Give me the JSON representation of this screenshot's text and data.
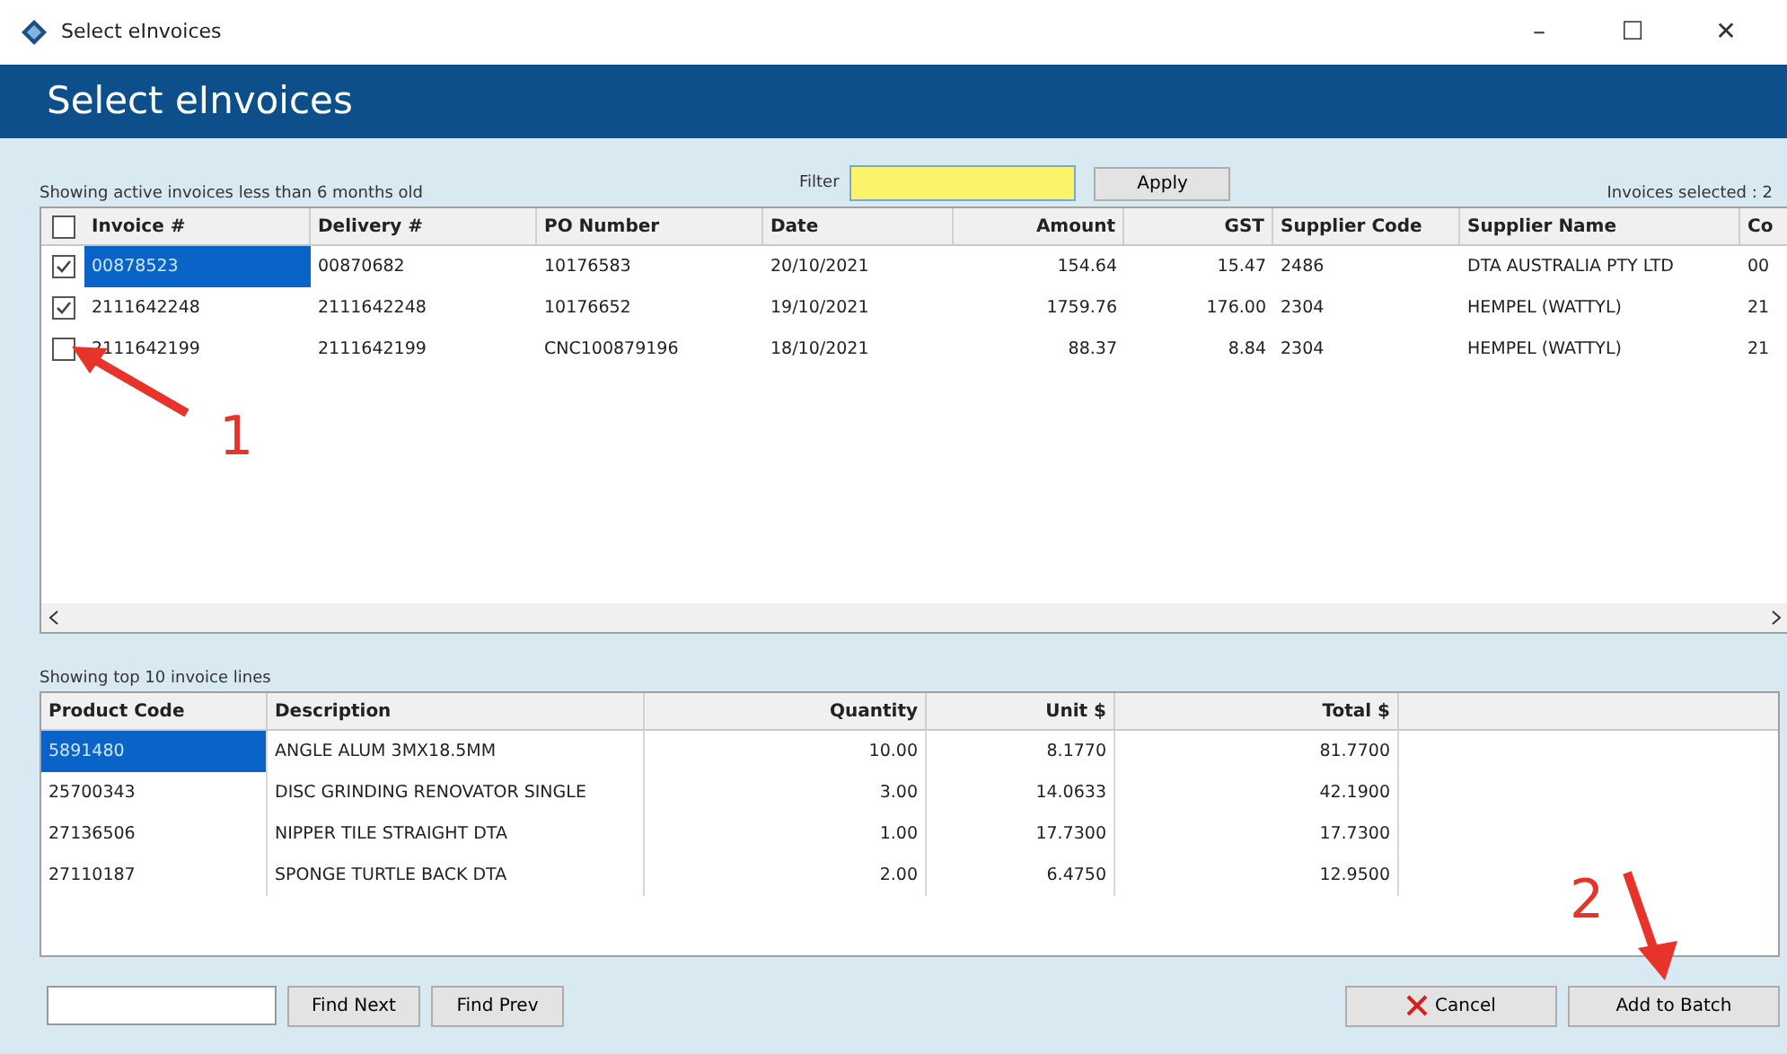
{
  "window": {
    "title": "Select eInvoices",
    "controls": [
      "–",
      "☐",
      "✕"
    ]
  },
  "header": {
    "title": "Select eInvoices"
  },
  "invoices": {
    "caption": "Showing active invoices less than 6 months old",
    "filter_label": "Filter",
    "apply": "Apply",
    "selected_count": "Invoices selected : 2",
    "all_checked": false,
    "columns": [
      "Invoice #",
      "Delivery #",
      "PO Number",
      "Date",
      "Amount",
      "GST",
      "Supplier Code",
      "Supplier Name",
      "Co"
    ],
    "rows": [
      {
        "checked": true,
        "selected": true,
        "cells": [
          "00878523",
          "00870682",
          "10176583",
          "20/10/2021",
          "154.64",
          "15.47",
          "2486",
          "DTA AUSTRALIA PTY LTD",
          "00"
        ]
      },
      {
        "checked": true,
        "selected": false,
        "cells": [
          "2111642248",
          "2111642248",
          "10176652",
          "19/10/2021",
          "1759.76",
          "176.00",
          "2304",
          "HEMPEL (WATTYL)",
          "21"
        ]
      },
      {
        "checked": false,
        "selected": false,
        "cells": [
          "2111642199",
          "2111642199",
          "CNC100879196",
          "18/10/2021",
          "88.37",
          "8.84",
          "2304",
          "HEMPEL (WATTYL)",
          "21"
        ]
      }
    ]
  },
  "lines": {
    "caption": "Showing top 10 invoice lines",
    "columns": [
      "Product Code",
      "Description",
      "Quantity",
      "Unit $",
      "Total $"
    ],
    "rows": [
      {
        "selected": true,
        "cells": [
          "5891480",
          "ANGLE ALUM 3MX18.5MM",
          "10.00",
          "8.1770",
          "81.7700"
        ]
      },
      {
        "selected": false,
        "cells": [
          "25700343",
          "DISC GRINDING RENOVATOR SINGLE",
          "3.00",
          "14.0633",
          "42.1900"
        ]
      },
      {
        "selected": false,
        "cells": [
          "27136506",
          "NIPPER TILE STRAIGHT DTA",
          "1.00",
          "17.7300",
          "17.7300"
        ]
      },
      {
        "selected": false,
        "cells": [
          "27110187",
          "SPONGE TURTLE BACK DTA",
          "2.00",
          "6.4750",
          "12.9500"
        ]
      }
    ]
  },
  "footer": {
    "find_next": "Find Next",
    "find_prev": "Find Prev",
    "cancel": "Cancel",
    "add": "Add to Batch"
  },
  "annotations": [
    {
      "label": "1"
    },
    {
      "label": "2"
    }
  ]
}
